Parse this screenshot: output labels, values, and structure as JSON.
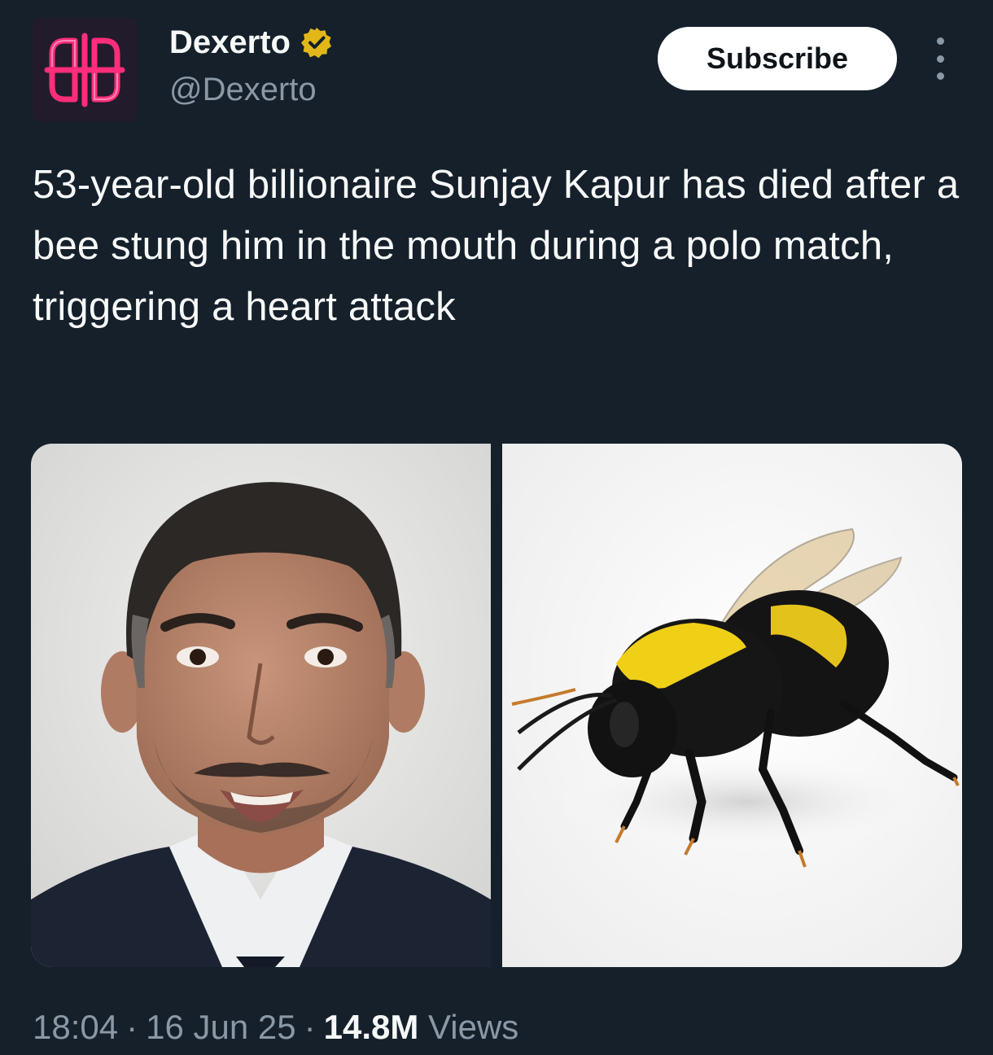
{
  "author": {
    "display_name": "Dexerto",
    "handle": "@Dexerto",
    "verified_badge": "verified-gold-check-icon",
    "avatar": "dexerto-logo-avatar"
  },
  "actions": {
    "subscribe_label": "Subscribe",
    "more_icon": "more-vertical-icon"
  },
  "tweet": {
    "text": "53-year-old billionaire Sunjay Kapur has died after a bee stung him in the mouth during a polo match, triggering a heart attack",
    "media": [
      {
        "description_icon": "portrait-photo"
      },
      {
        "description_icon": "bumblebee-photo"
      }
    ]
  },
  "meta": {
    "time": "18:04",
    "date": "16 Jun 25",
    "views_count": "14.8M",
    "views_label": "Views",
    "separator": "·"
  },
  "colors": {
    "background": "#15202b",
    "text_primary": "#f7f9f9",
    "text_secondary": "#8b98a5",
    "verified_gold": "#e2b719",
    "logo_neon": "#ff2d7a"
  }
}
